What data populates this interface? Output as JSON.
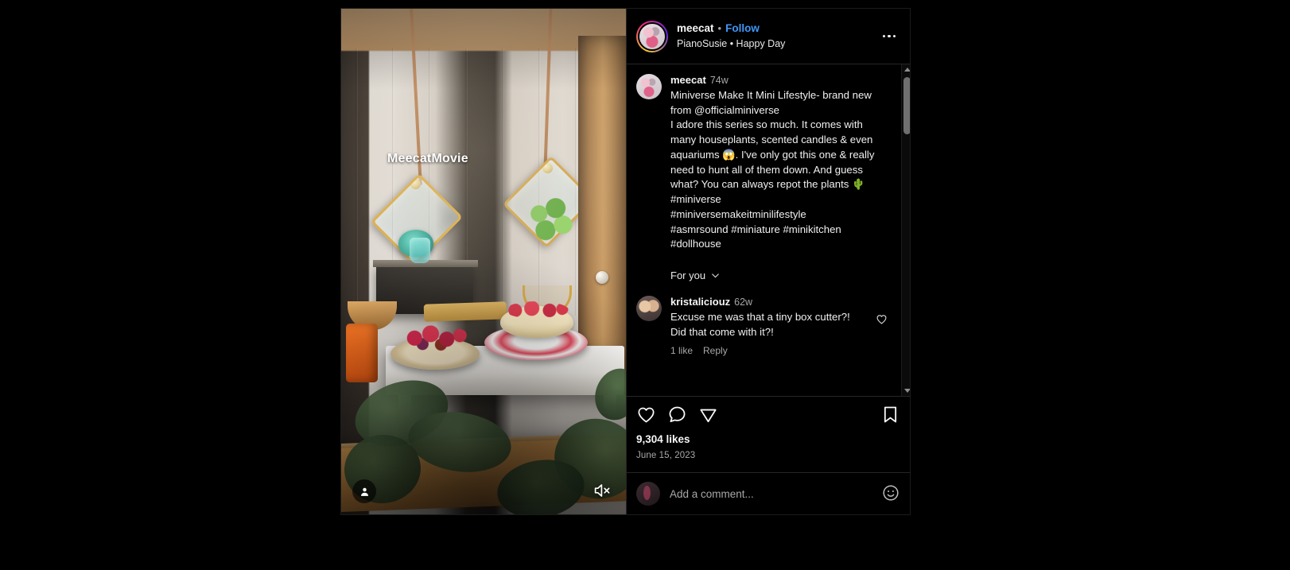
{
  "app": "instagram-post-view",
  "colors": {
    "background": "#000000",
    "panel": "#000000",
    "border": "#262626",
    "text_primary": "#f5f5f5",
    "text_secondary": "#a8a8a8",
    "link_blue": "#3f97f6",
    "scrollbar_thumb": "#6f6f6f"
  },
  "media": {
    "watermark": "MeecatMovie",
    "tag_icon": "person-tag-icon",
    "mute_icon": "speaker-muted-icon",
    "muted": true
  },
  "header": {
    "username": "meecat",
    "separator": "•",
    "follow_label": "Follow",
    "audio_track": "PianoSusie • Happy Day",
    "more_icon": "more-options-icon",
    "avatar_icon": "profile-avatar"
  },
  "caption": {
    "username": "meecat",
    "timestamp": "74w",
    "text": "Miniverse Make It Mini Lifestyle- brand new from @officialminiverse\nI adore this series so much. It comes with many houseplants, scented candles & even aquariums 😱. I've only got this one & really need to hunt all of them down. And guess what? You can always repot the plants 🌵\n#miniverse\n#miniversemakeitminilifestyle\n#asmrsound #miniature #minikitchen\n#dollhouse"
  },
  "comments_filter": {
    "label": "For you",
    "chevron_icon": "chevron-down-icon"
  },
  "comments": [
    {
      "username": "kristaliciouz",
      "timestamp": "62w",
      "text": "Excuse me was that a tiny box cutter?! Did that come with it?!",
      "likes_label": "1 like",
      "reply_label": "Reply",
      "like_icon": "heart-outline-icon"
    }
  ],
  "actions": {
    "like_icon": "heart-outline-icon",
    "comment_icon": "comment-bubble-icon",
    "share_icon": "share-paper-plane-icon",
    "save_icon": "bookmark-outline-icon",
    "likes_count": "9,304 likes",
    "post_date": "June 15, 2023"
  },
  "composer": {
    "placeholder": "Add a comment...",
    "value": "",
    "emoji_icon": "emoji-smiley-icon",
    "avatar_icon": "current-user-avatar"
  },
  "scrollbar": {
    "up_icon": "scroll-up-arrow-icon",
    "down_icon": "scroll-down-arrow-icon"
  }
}
